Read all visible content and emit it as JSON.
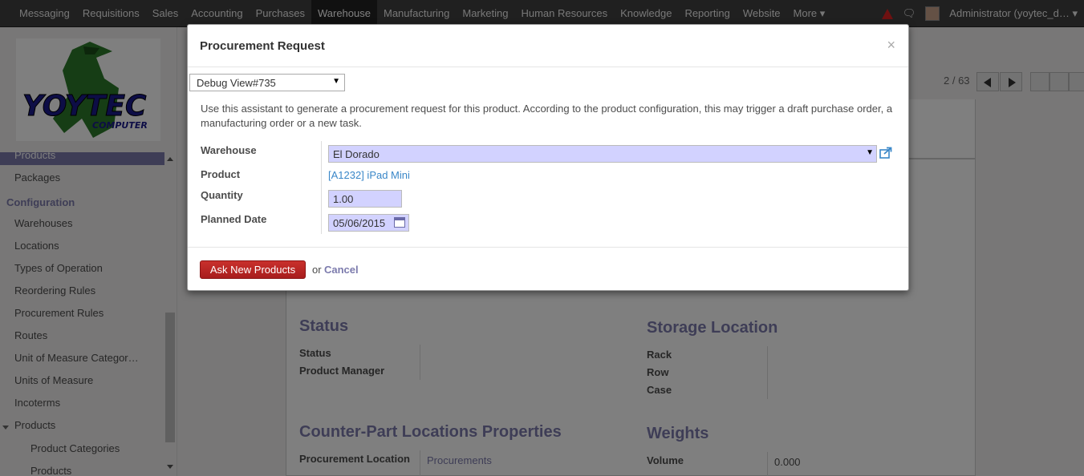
{
  "topbar": {
    "menu": [
      "Messaging",
      "Requisitions",
      "Sales",
      "Accounting",
      "Purchases",
      "Warehouse",
      "Manufacturing",
      "Marketing",
      "Human Resources",
      "Knowledge",
      "Reporting",
      "Website",
      "More ▾"
    ],
    "active": "Warehouse",
    "user": "Administrator (yoytec_d… ▾"
  },
  "sidebar": {
    "logo_text": "YOYTEC COMPUTER",
    "active_item": "Products",
    "items_top": [
      "Packages"
    ],
    "config_header": "Configuration",
    "config_items": [
      "Warehouses",
      "Locations",
      "Types of Operation",
      "Reordering Rules",
      "Procurement Rules",
      "Routes",
      "Unit of Measure Categor…",
      "Units of Measure",
      "Incoterms"
    ],
    "products_group": "Products",
    "products_items": [
      "Product Categories",
      "Products"
    ]
  },
  "background": {
    "pager": "2 / 63",
    "sections": {
      "status_title": "Status",
      "status_label": "Status",
      "product_manager_label": "Product Manager",
      "storage_title": "Storage Location",
      "rack_label": "Rack",
      "row_label": "Row",
      "case_label": "Case",
      "counterpart_title": "Counter-Part Locations Properties",
      "procurement_location_label": "Procurement Location",
      "procurement_location_value": "Procurements",
      "weights_title": "Weights",
      "volume_label": "Volume",
      "volume_value": "0.000"
    }
  },
  "modal": {
    "title": "Procurement Request",
    "close": "×",
    "debug_view": "Debug View#735",
    "help": "Use this assistant to generate a procurement request for this product. According to the product configuration, this may trigger a draft purchase order, a manufacturing order or a new task.",
    "fields": {
      "warehouse_label": "Warehouse",
      "warehouse_value": "El Dorado",
      "product_label": "Product",
      "product_value": "[A1232] iPad Mini",
      "quantity_label": "Quantity",
      "quantity_value": "1.00",
      "planned_date_label": "Planned Date",
      "planned_date_value": "05/06/2015"
    },
    "buttons": {
      "submit": "Ask New Products",
      "or": "or",
      "cancel": "Cancel"
    }
  },
  "colors": {
    "accent": "#7c7bad",
    "primary_button": "#b52525",
    "required_field": "#d2d2ff"
  }
}
